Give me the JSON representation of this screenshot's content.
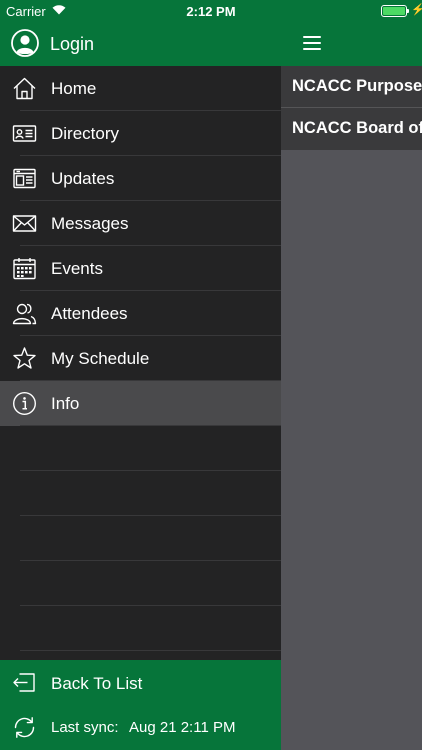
{
  "status_bar": {
    "carrier": "Carrier",
    "time": "2:12 PM",
    "battery_percent": 100,
    "charging": true
  },
  "drawer": {
    "login_label": "Login",
    "menu_items": [
      {
        "label": "Home",
        "icon": "home-icon"
      },
      {
        "label": "Directory",
        "icon": "directory-icon"
      },
      {
        "label": "Updates",
        "icon": "updates-icon"
      },
      {
        "label": "Messages",
        "icon": "envelope-icon"
      },
      {
        "label": "Events",
        "icon": "calendar-icon"
      },
      {
        "label": "Attendees",
        "icon": "people-icon"
      },
      {
        "label": "My Schedule",
        "icon": "star-icon"
      },
      {
        "label": "Info",
        "icon": "info-icon",
        "selected": true
      }
    ],
    "footer": {
      "back_label": "Back To List",
      "sync_label": "Last sync:",
      "sync_value": "Aug 21 2:11 PM"
    }
  },
  "main": {
    "menu_button_icon": "hamburger-icon",
    "rows": [
      {
        "label": "NCACC Purpose"
      },
      {
        "label": "NCACC Board of"
      }
    ]
  },
  "colors": {
    "brand_green": "#06753a",
    "drawer_bg": "#232324",
    "selected_row": "#4a4a4c",
    "main_bg": "#545459",
    "battery_green": "#4cd964"
  }
}
